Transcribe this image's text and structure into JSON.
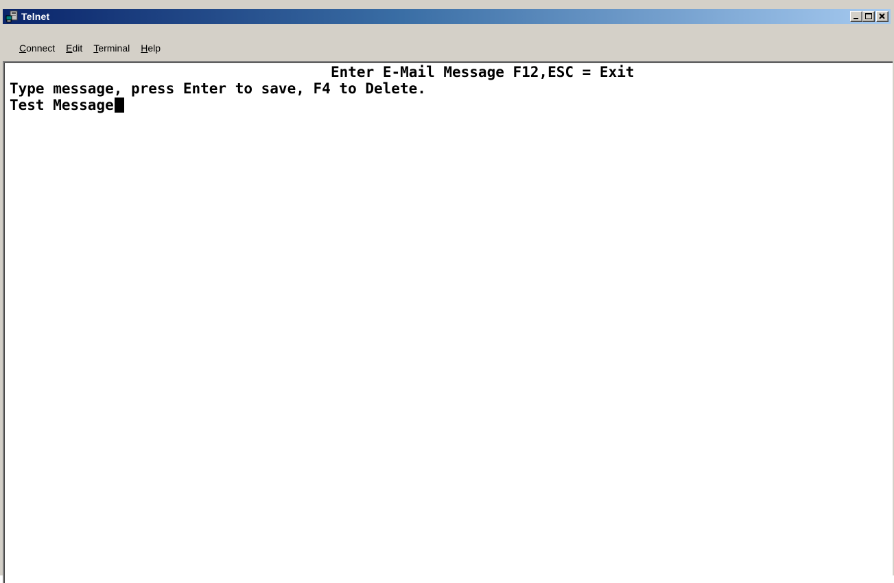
{
  "window": {
    "title": "Telnet"
  },
  "menu": {
    "items": [
      {
        "label": "Connect",
        "mnemonic": "C",
        "rest": "onnect"
      },
      {
        "label": "Edit",
        "mnemonic": "E",
        "rest": "dit"
      },
      {
        "label": "Terminal",
        "mnemonic": "T",
        "rest": "erminal"
      },
      {
        "label": "Help",
        "mnemonic": "H",
        "rest": "elp"
      }
    ]
  },
  "terminal": {
    "header": "Enter E-Mail Message F12,ESC = Exit",
    "instructions": "Type message, press Enter to save, F4 to Delete.",
    "input_text": "Test Message"
  },
  "icons": {
    "app": "telnet-computer-icon",
    "minimize": "minimize-icon",
    "maximize": "maximize-icon",
    "close": "close-icon"
  },
  "colors": {
    "title_gradient_start": "#0a246a",
    "title_gradient_end": "#a6caf0",
    "chrome": "#d4d0c8",
    "terminal_bg": "#ffffff",
    "terminal_text": "#000000"
  }
}
